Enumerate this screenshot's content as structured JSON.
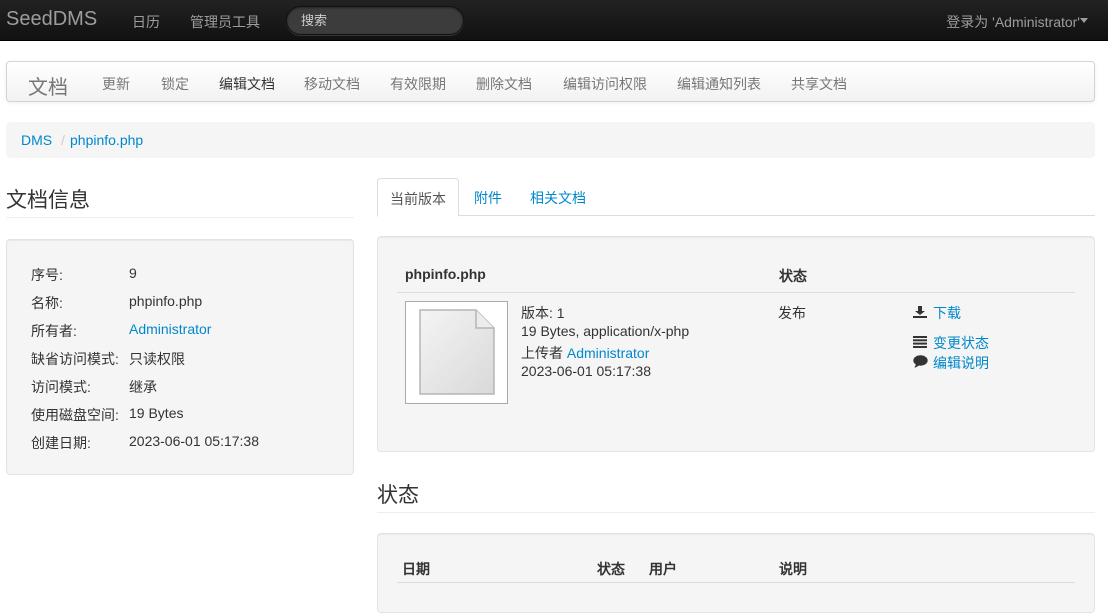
{
  "navbar": {
    "brand": "SeedDMS",
    "links": [
      "日历",
      "管理员工具"
    ],
    "search_placeholder": "搜索",
    "login": "登录为 'Administrator'"
  },
  "subnav": {
    "title": "文档",
    "items": [
      "更新",
      "锁定",
      "编辑文档",
      "移动文档",
      "有效限期",
      "删除文档",
      "编辑访问权限",
      "编辑通知列表",
      "共享文档"
    ],
    "active": "编辑文档"
  },
  "breadcrumb": [
    "DMS",
    "phpinfo.php"
  ],
  "doc_info": {
    "title": "文档信息",
    "rows": [
      {
        "label": "序号:",
        "value": "9"
      },
      {
        "label": "名称:",
        "value": "phpinfo.php"
      },
      {
        "label": "所有者:",
        "value": "Administrator"
      },
      {
        "label": "缺省访问模式:",
        "value": "只读权限"
      },
      {
        "label": "访问模式:",
        "value": "继承"
      },
      {
        "label": "使用磁盘空间:",
        "value": "19 Bytes"
      },
      {
        "label": "创建日期:",
        "value": "2023-06-01 05:17:38"
      }
    ]
  },
  "tabs": [
    "当前版本",
    "附件",
    "相关文档"
  ],
  "version": {
    "header_name": "phpinfo.php",
    "header_status": "状态",
    "version_label": "版本: 1",
    "size_type": "19 Bytes, application/x-php",
    "uploader_prefix": "上传者",
    "uploader": "Administrator",
    "date": "2023-06-01 05:17:38",
    "status": "发布",
    "actions": {
      "download": "下载",
      "change_status": "变更状态",
      "edit_comment": "编辑说明"
    }
  },
  "status_section": {
    "title": "状态",
    "columns": [
      "日期",
      "状态",
      "用户",
      "说明"
    ]
  }
}
